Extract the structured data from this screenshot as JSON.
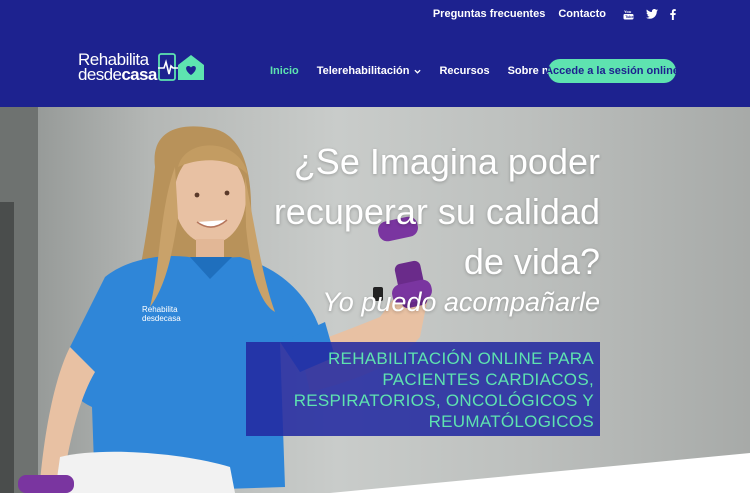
{
  "topbar": {
    "links": [
      "Preguntas frecuentes",
      "Contacto"
    ],
    "social_icons": [
      "youtube-icon",
      "twitter-icon",
      "facebook-icon"
    ]
  },
  "logo": {
    "line1": "Rehabilita",
    "line2_light": "desde",
    "line2_bold": "casa"
  },
  "nav": {
    "items": [
      {
        "label": "Inicio",
        "active": true
      },
      {
        "label": "Telerehabilitación",
        "has_dropdown": true
      },
      {
        "label": "Recursos"
      },
      {
        "label": "Sobre mí"
      }
    ],
    "cta_label": "Accede a la sesión online"
  },
  "hero": {
    "headline_line1": "¿Se Imagina poder",
    "headline_line2": "recuperar su calidad",
    "headline_line3": "de vida?",
    "subline": "Yo puedo acompañarle",
    "banner_line1": "REHABILITACIÓN ONLINE PARA",
    "banner_line2": "PACIENTES CARDIACOS,",
    "banner_line3": "RESPIRATORIOS, ONCOLÓGICOS Y",
    "banner_line4": "REUMATÓLOGICOS"
  },
  "colors": {
    "brand_blue": "#1d228f",
    "accent_green": "#5ee3b0",
    "banner_blue": "#232aa0",
    "white": "#ffffff"
  }
}
